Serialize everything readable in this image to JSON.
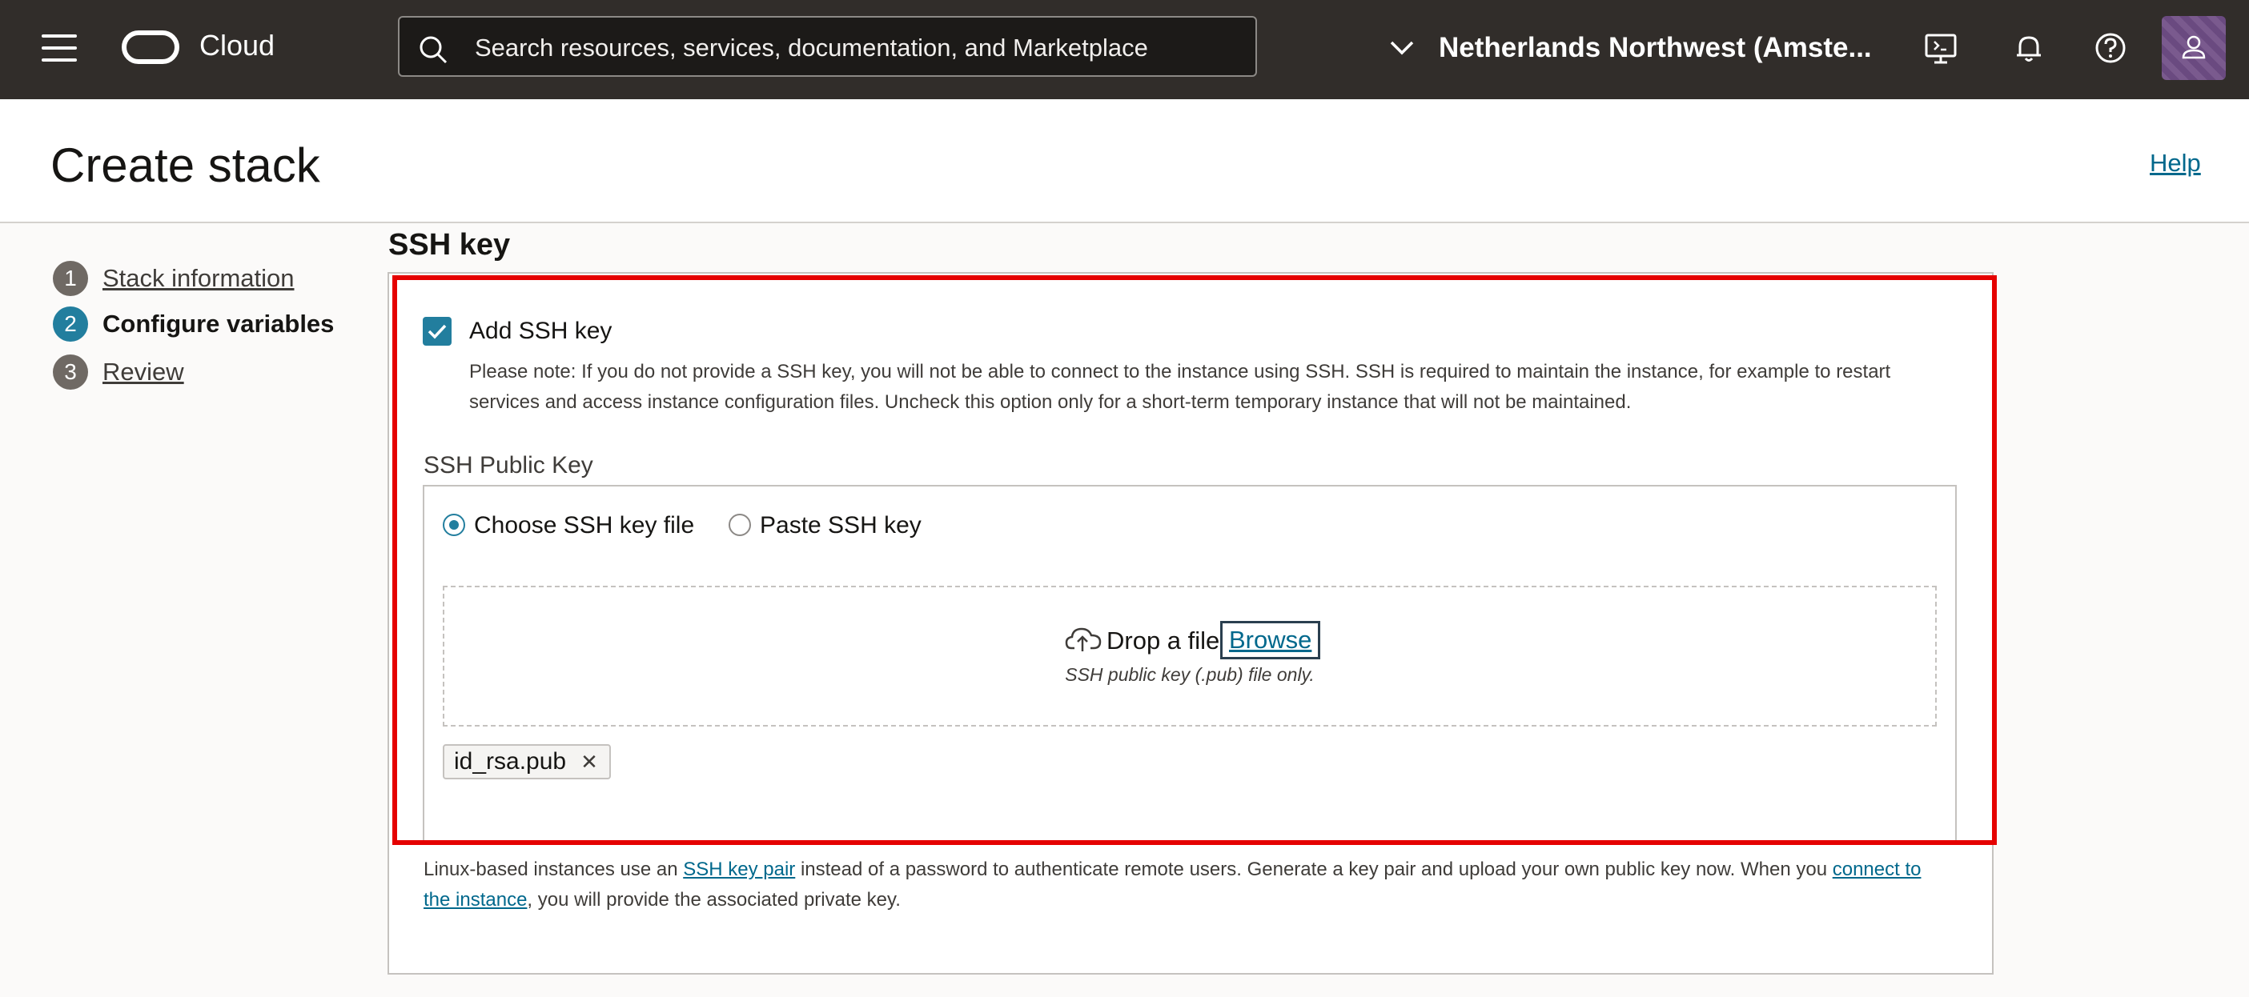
{
  "topbar": {
    "brand": "Cloud",
    "search_placeholder": "Search resources, services, documentation, and Marketplace",
    "region": "Netherlands Northwest (Amste..."
  },
  "header": {
    "title": "Create stack",
    "help": "Help"
  },
  "steps": [
    {
      "num": "1",
      "label": "Stack information",
      "state": "done"
    },
    {
      "num": "2",
      "label": "Configure variables",
      "state": "active"
    },
    {
      "num": "3",
      "label": "Review",
      "state": "todo"
    }
  ],
  "section": {
    "title": "SSH key",
    "add_ssh_label": "Add SSH key",
    "add_ssh_checked": true,
    "note": "Please note: If you do not provide a SSH key, you will not be able to connect to the instance using SSH. SSH is required to maintain the instance, for example to restart services and access instance configuration files. Uncheck this option only for a short-term temporary instance that will not be maintained.",
    "public_key_label": "SSH Public Key",
    "radio_choose": "Choose SSH key file",
    "radio_paste": "Paste SSH key",
    "selected_radio": "Choose SSH key file",
    "drop_text": "Drop a file",
    "browse": "Browse",
    "drop_hint": "SSH public key (.pub) file only.",
    "file_chip": "id_rsa.pub",
    "bottom_note": {
      "part1": "Linux-based instances use an ",
      "link1": "SSH key pair",
      "part2": " instead of a password to authenticate remote users. Generate a key pair and upload your own public key now. When you ",
      "link2": "connect to the instance",
      "part3": ", you will provide the associated private key."
    }
  },
  "colors": {
    "topbar": "#312d2a",
    "accent": "#227e9e",
    "link": "#00688c",
    "highlight": "#e50000"
  },
  "icons": [
    "menu-icon",
    "oracle-logo",
    "search-icon",
    "chevron-down-icon",
    "cloud-shell-icon",
    "bell-icon",
    "help-icon",
    "user-icon",
    "cloud-upload-icon",
    "close-icon",
    "check-icon"
  ]
}
